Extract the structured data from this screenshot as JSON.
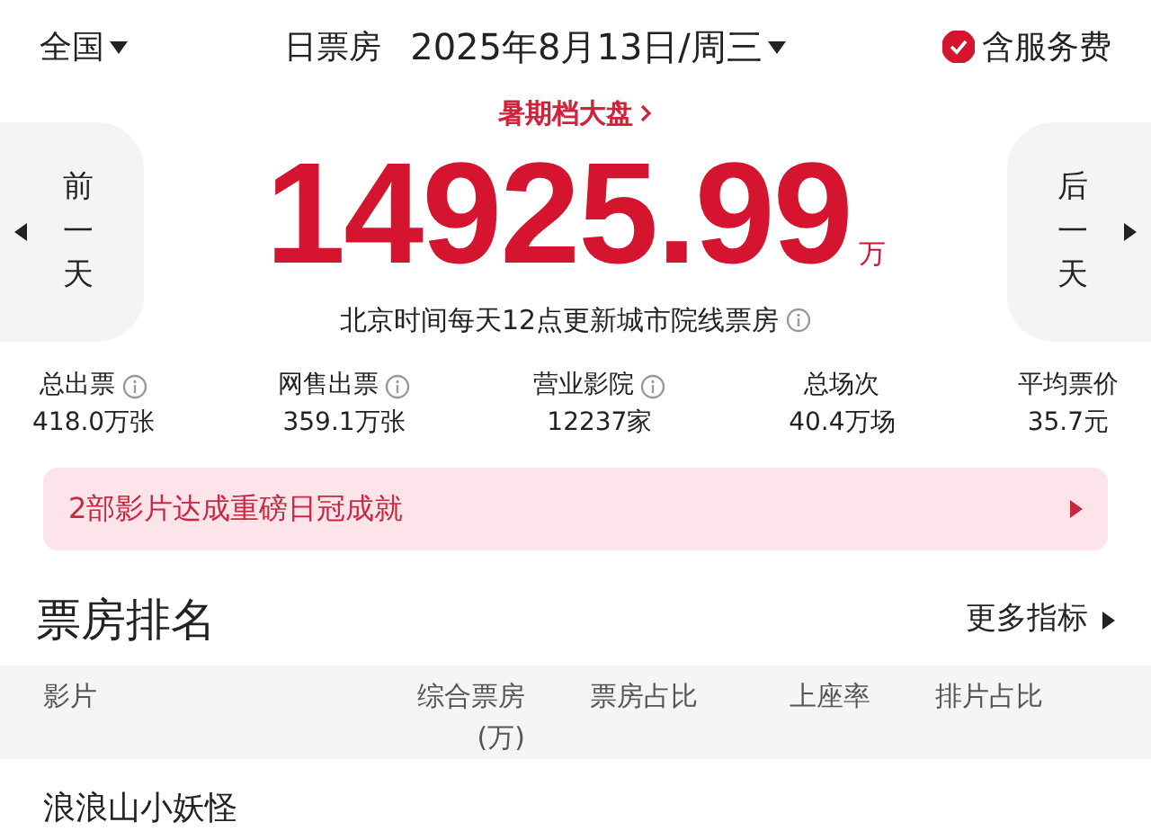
{
  "header": {
    "region": "全国",
    "title": "日票房",
    "date": "2025年8月13日/周三",
    "service_fee": {
      "label": "含服务费",
      "checked": true
    }
  },
  "season_link": "暑期档大盘",
  "total": {
    "value": "14925.99",
    "unit": "万"
  },
  "prev_day": [
    "前",
    "一",
    "天"
  ],
  "next_day": [
    "后",
    "一",
    "天"
  ],
  "update_note": "北京时间每天12点更新城市院线票房",
  "stats": [
    {
      "label": "总出票",
      "info": true,
      "value": "418.0万张"
    },
    {
      "label": "网售出票",
      "info": true,
      "value": "359.1万张"
    },
    {
      "label": "营业影院",
      "info": true,
      "value": "12237家"
    },
    {
      "label": "总场次",
      "info": false,
      "value": "40.4万场"
    },
    {
      "label": "平均票价",
      "info": false,
      "value": "35.7元"
    }
  ],
  "banner": "2部影片达成重磅日冠成就",
  "ranking": {
    "title": "票房排名",
    "more": "更多指标",
    "columns": [
      [
        "影片"
      ],
      [
        "综合票房",
        "(万)"
      ],
      [
        "票房占比"
      ],
      [
        "上座率"
      ],
      [
        "排片占比"
      ]
    ],
    "rows": [
      {
        "film": "浪浪山小妖怪"
      }
    ]
  }
}
